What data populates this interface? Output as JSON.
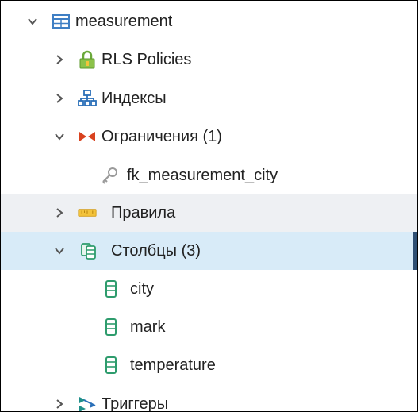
{
  "tree": {
    "table": {
      "label": "measurement",
      "icon": "table-icon"
    },
    "rls": {
      "label": "RLS Policies",
      "icon": "lock-icon"
    },
    "indexes": {
      "label": "Индексы",
      "icon": "index-icon"
    },
    "constraints": {
      "label": "Ограничения (1)",
      "icon": "constraint-icon"
    },
    "fk": {
      "label": "fk_measurement_city",
      "icon": "key-icon"
    },
    "rules": {
      "label": "Правила",
      "icon": "rules-icon"
    },
    "columns": {
      "label": "Столбцы (3)",
      "icon": "columns-icon",
      "items": [
        {
          "label": "city",
          "icon": "column-icon"
        },
        {
          "label": "mark",
          "icon": "column-icon"
        },
        {
          "label": "temperature",
          "icon": "column-icon"
        }
      ]
    },
    "triggers": {
      "label": "Триггеры",
      "icon": "trigger-icon"
    }
  },
  "colors": {
    "selected_bg": "#d8ebf8",
    "selected_bar": "#2f4f73",
    "hover_bg": "#eef0f3",
    "column_icon": "#2e9c6d",
    "table_icon": "#3f7fc4",
    "constraint_icon": "#d9421f",
    "lock_icon": "#6aa83a",
    "rules_icon": "#f0b429"
  }
}
